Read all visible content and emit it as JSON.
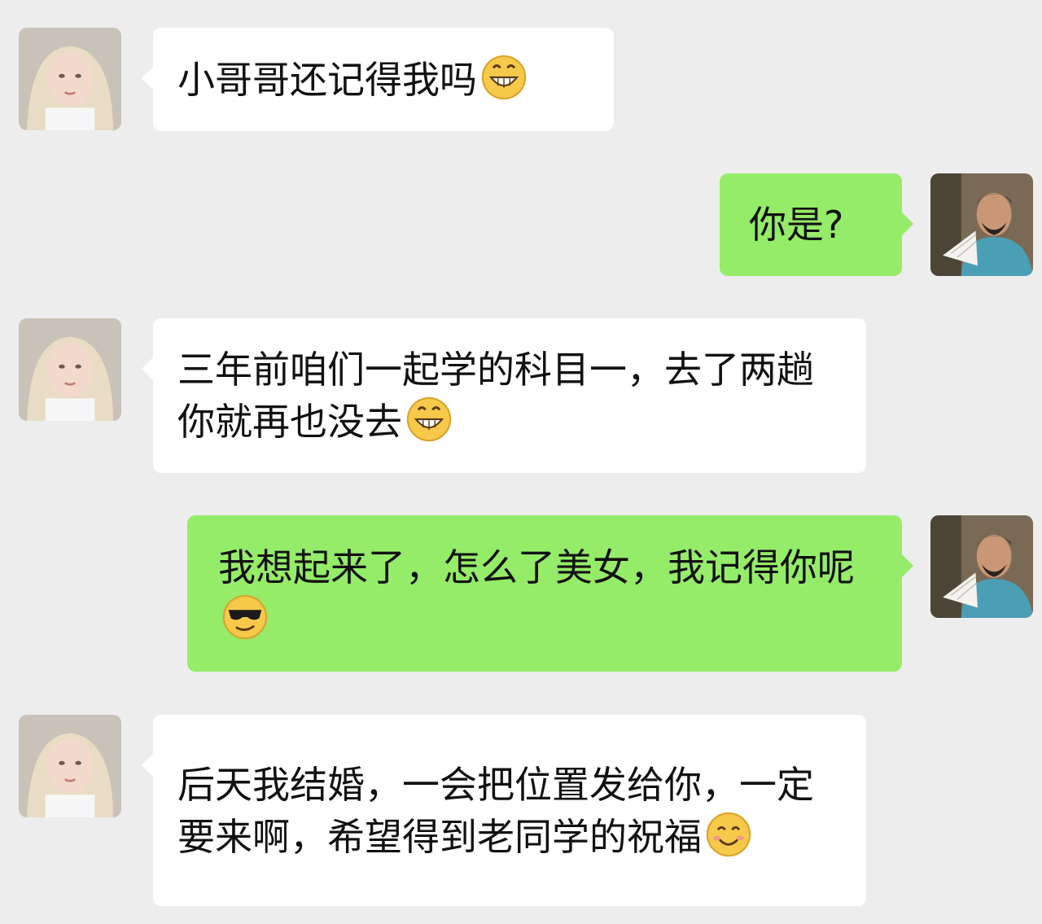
{
  "chat": {
    "messages": [
      {
        "side": "left",
        "text": "小哥哥还记得我吗",
        "emoji": "grin-emoji"
      },
      {
        "side": "right",
        "text": "你是?"
      },
      {
        "side": "left",
        "text": "三年前咱们一起学的科目一，去了两趟你就再也没去",
        "emoji": "grin-emoji"
      },
      {
        "side": "right",
        "text": "我想起来了，怎么了美女，我记得你呢",
        "emoji": "sunglasses-emoji"
      },
      {
        "side": "left",
        "text": "后天我结婚，一会把位置发给你，一定要来啊，希望得到老同学的祝福",
        "emoji": "smile-emoji"
      }
    ]
  },
  "colors": {
    "background": "#ededed",
    "incoming_bubble": "#ffffff",
    "outgoing_bubble": "#95ec69"
  }
}
